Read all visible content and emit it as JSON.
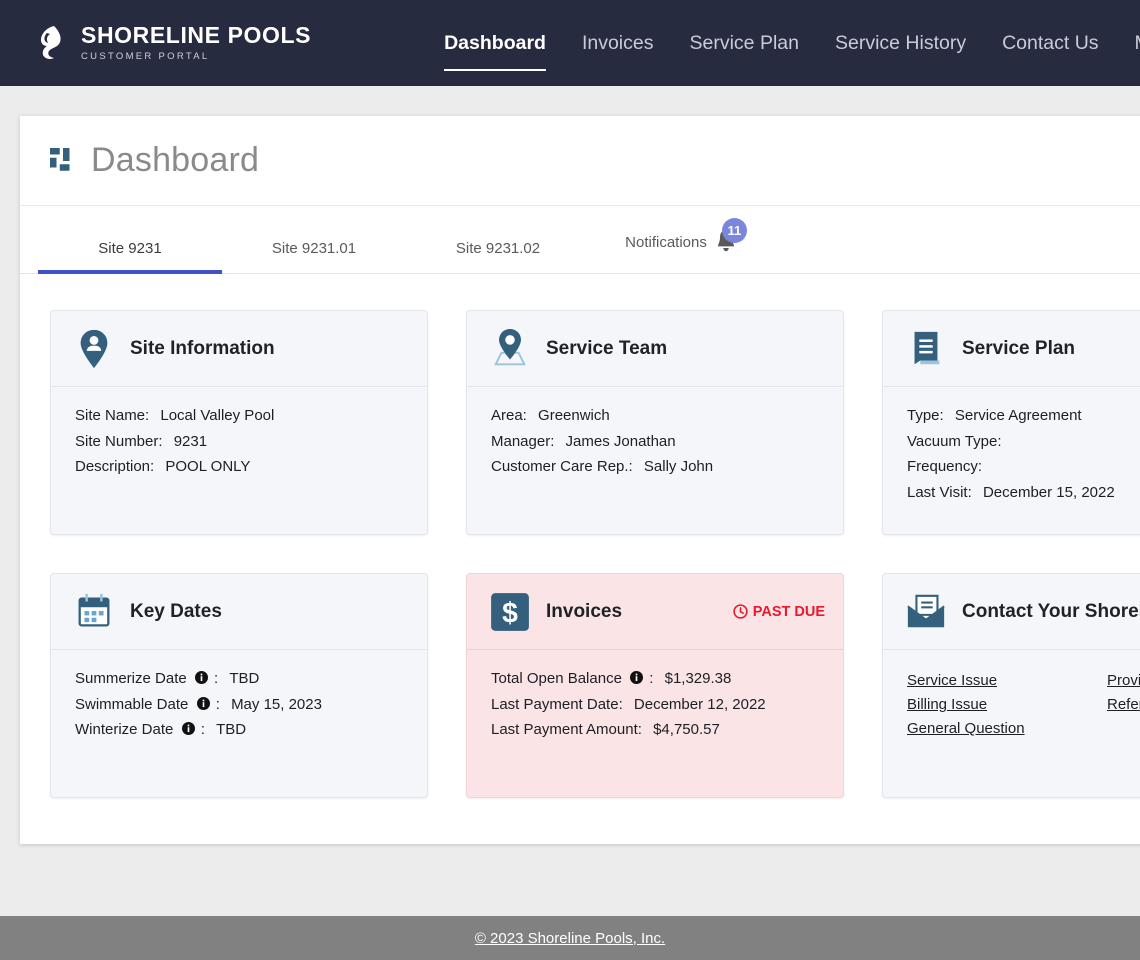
{
  "brand": {
    "name": "SHORELINE POOLS",
    "subtitle": "CUSTOMER PORTAL",
    "logo_icon": "shoreline-wave-logo"
  },
  "nav": {
    "items": [
      {
        "label": "Dashboard",
        "active": true
      },
      {
        "label": "Invoices",
        "active": false
      },
      {
        "label": "Service Plan",
        "active": false
      },
      {
        "label": "Service History",
        "active": false
      },
      {
        "label": "Contact Us",
        "active": false
      },
      {
        "label": "My Ac",
        "active": false
      }
    ]
  },
  "page": {
    "title": "Dashboard",
    "icon": "dashboard-grid-icon"
  },
  "tabs": {
    "items": [
      {
        "label": "Site 9231",
        "active": true
      },
      {
        "label": "Site 9231.01",
        "active": false
      },
      {
        "label": "Site 9231.02",
        "active": false
      },
      {
        "label": "Notifications",
        "active": false,
        "badge": "11",
        "icon": "bell-icon"
      }
    ]
  },
  "cards": {
    "site_information": {
      "title": "Site Information",
      "icon": "map-pin-person-icon",
      "rows": [
        {
          "label": "Site Name:",
          "value": "Local Valley Pool"
        },
        {
          "label": "Site Number:",
          "value": "9231"
        },
        {
          "label": "Description:",
          "value": "POOL ONLY"
        }
      ]
    },
    "service_team": {
      "title": "Service Team",
      "icon": "map-location-icon",
      "rows": [
        {
          "label": "Area:",
          "value": "Greenwich"
        },
        {
          "label": "Manager:",
          "value": "James Jonathan"
        },
        {
          "label": "Customer Care Rep.:",
          "value": "Sally John"
        }
      ]
    },
    "service_plan": {
      "title": "Service Plan",
      "icon": "document-lines-icon",
      "rows": [
        {
          "label": "Type:",
          "value": "Service Agreement"
        },
        {
          "label": "Vacuum Type:",
          "value": ""
        },
        {
          "label": "Frequency:",
          "value": ""
        },
        {
          "label": "Last Visit:",
          "value": "December 15, 2022"
        }
      ]
    },
    "key_dates": {
      "title": "Key Dates",
      "icon": "calendar-icon",
      "rows": [
        {
          "label": "Summerize Date",
          "info": "info-icon",
          "sep": ":",
          "value": "TBD"
        },
        {
          "label": "Swimmable Date",
          "info": "info-icon",
          "sep": ":",
          "value": "May 15, 2023"
        },
        {
          "label": "Winterize Date",
          "info": "info-icon",
          "sep": ":",
          "value": "TBD"
        }
      ]
    },
    "invoices": {
      "title": "Invoices",
      "icon": "dollar-sign-icon",
      "status_badge": "PAST DUE",
      "status_icon": "clock-icon",
      "status_color": "#e8192c",
      "rows": [
        {
          "label": "Total Open Balance",
          "info": "info-icon",
          "sep": ":",
          "value": "$1,329.38"
        },
        {
          "label": "Last Payment Date:",
          "sep": "",
          "value": "December 12, 2022"
        },
        {
          "label": "Last Payment Amount:",
          "sep": "",
          "value": "$4,750.57"
        }
      ]
    },
    "contact": {
      "title": "Contact Your Shorelin",
      "icon": "envelope-icon",
      "links": [
        "Service Issue",
        "Provide ",
        "Billing Issue",
        "Refer A ",
        "General Question",
        ""
      ]
    }
  },
  "footer": {
    "copyright": "© 2023 Shoreline Pools, Inc."
  },
  "colors": {
    "nav_background": "#272b3f",
    "accent_blue": "#3f51c4",
    "icon_slate": "#34607d",
    "badge_purple": "#7a85dd",
    "alert_red": "#e8192c",
    "card_background": "#f4f6fa",
    "alert_card_background": "#fbe4e6",
    "footer_background": "#818181"
  }
}
